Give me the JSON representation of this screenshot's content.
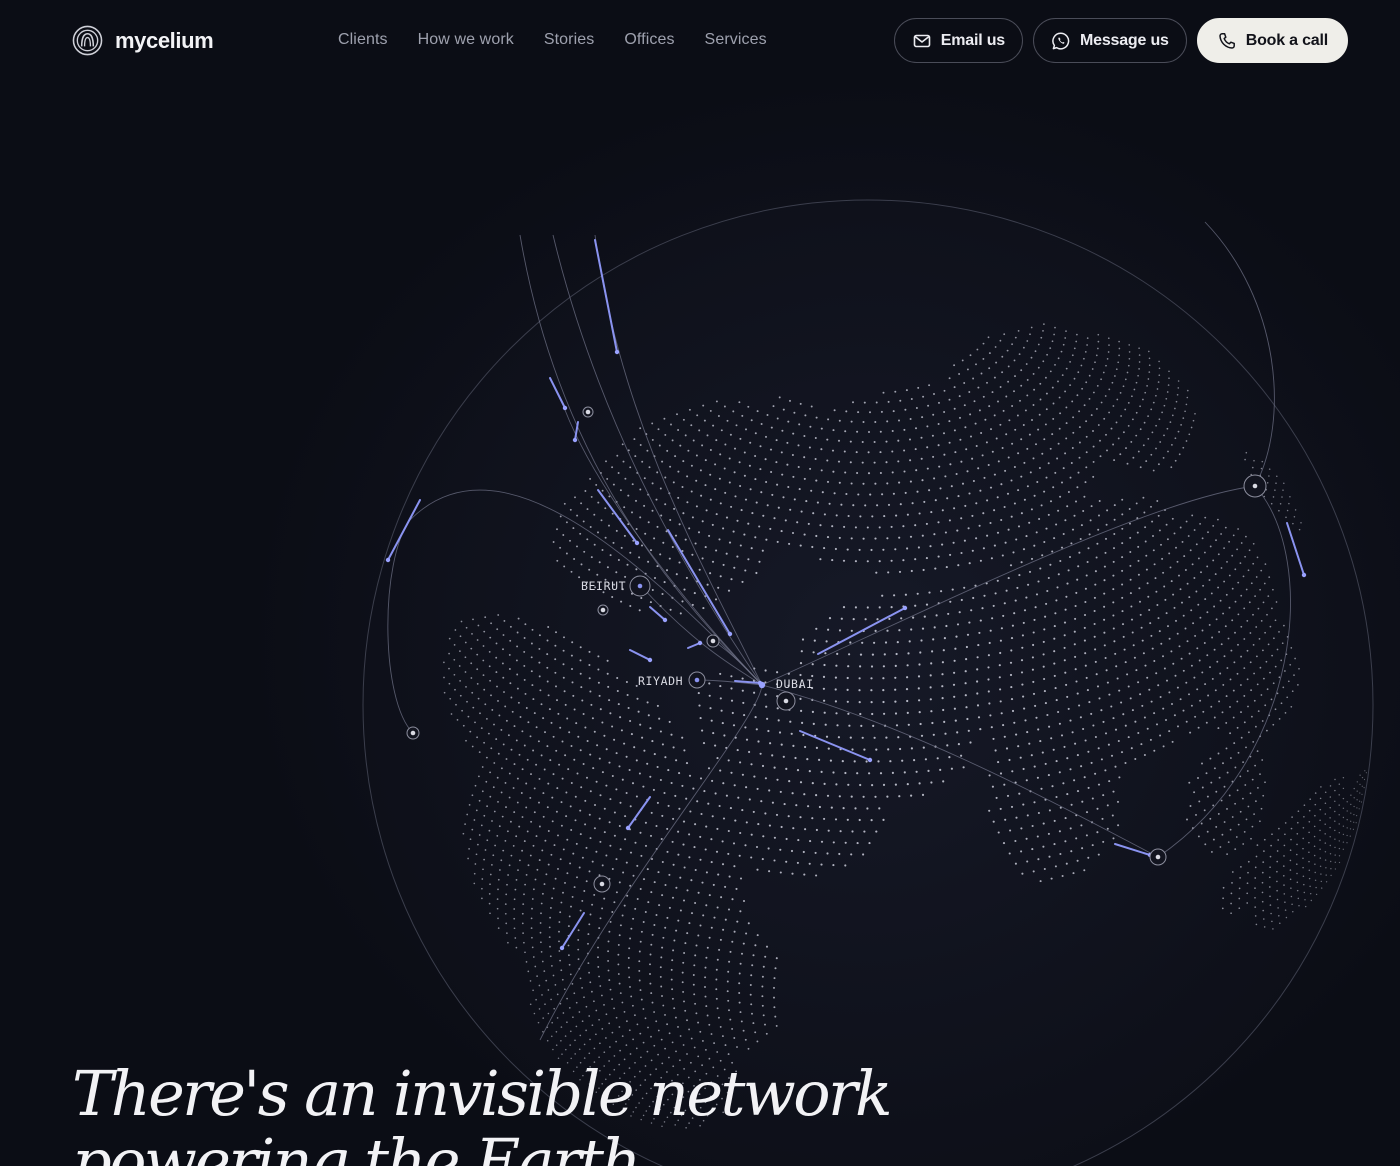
{
  "brand": {
    "name": "mycelium"
  },
  "nav": {
    "items": [
      {
        "label": "Clients"
      },
      {
        "label": "How we work"
      },
      {
        "label": "Stories"
      },
      {
        "label": "Offices"
      },
      {
        "label": "Services"
      }
    ]
  },
  "actions": {
    "email_label": "Email us",
    "message_label": "Message us",
    "book_label": "Book a call"
  },
  "map": {
    "cities": [
      {
        "label": "BEIRUT"
      },
      {
        "label": "RIYADH"
      },
      {
        "label": "DUBAI"
      }
    ]
  },
  "hero": {
    "line1": "There's an invisible network",
    "line2": "powering the Earth"
  },
  "colors": {
    "background": "#0c0e17",
    "accent": "#8a93f0",
    "button_light": "#efeee9",
    "dots": "#c9cbd8"
  },
  "icons": {
    "logo": "mycelium-logo-icon",
    "email": "envelope-icon",
    "message": "whatsapp-icon",
    "book": "phone-icon"
  }
}
